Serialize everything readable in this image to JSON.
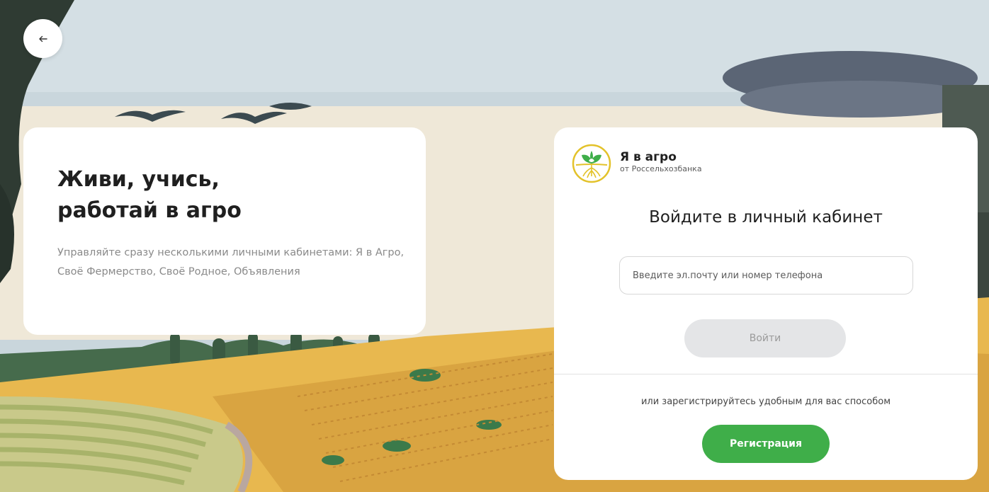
{
  "colors": {
    "accent_green": "#3fae49",
    "disabled_button": "#e4e5e7",
    "card_bg": "#ffffff",
    "heading": "#1f1f1f",
    "muted_text": "#8a8a8a"
  },
  "nav": {
    "back_icon": "arrow-left-icon"
  },
  "promo": {
    "heading_line1": "Живи, учись,",
    "heading_line2": "работай в агро",
    "description": "Управляйте сразу несколькими личными кабинетами: Я в Агро, Своё Фермерство, Своё Родное, Объявления"
  },
  "brand": {
    "logo_icon": "sprout-logo-icon",
    "name": "Я в агро",
    "subtitle": "от Россельхозбанка"
  },
  "login": {
    "title": "Войдите в личный кабинет",
    "input_placeholder": "Введите эл.почту или номер телефона",
    "input_value": "",
    "submit_label": "Войти"
  },
  "register": {
    "hint": "или зарегистрируйтесь удобным для вас способом",
    "button_label": "Регистрация"
  }
}
